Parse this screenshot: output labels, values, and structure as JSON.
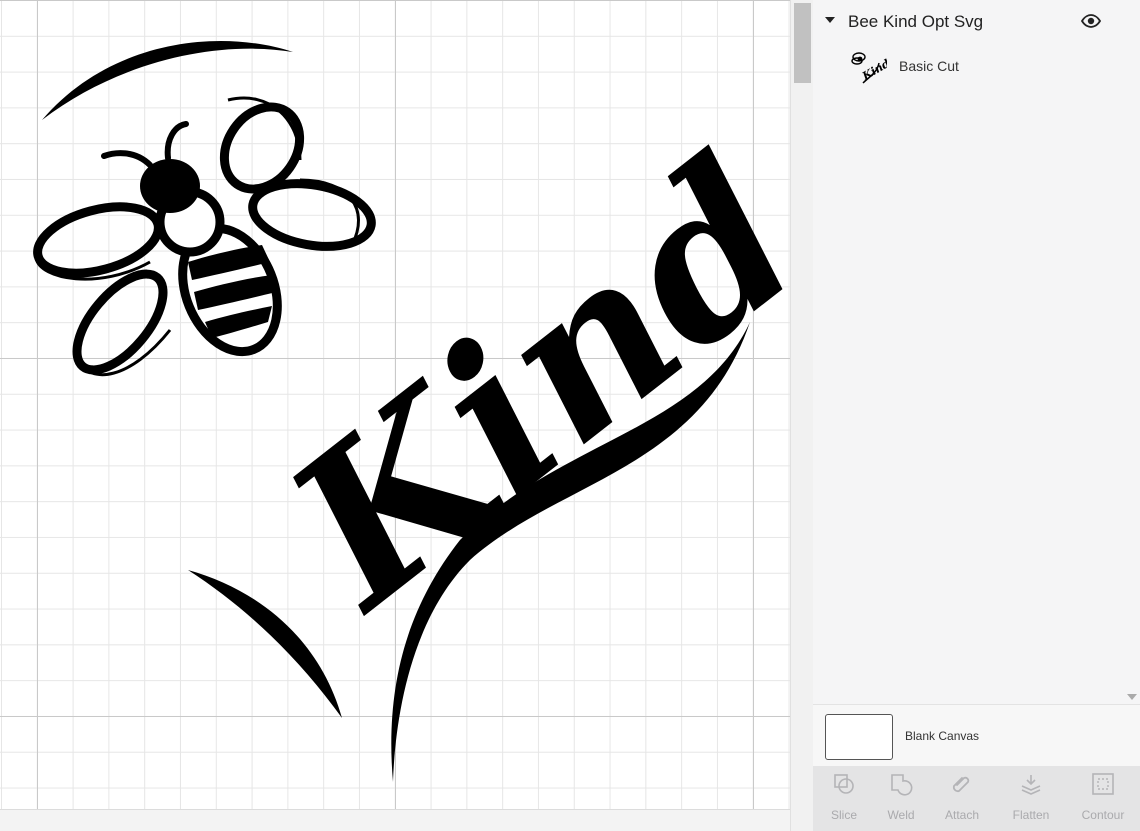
{
  "layers_panel": {
    "group": {
      "title": "Bee Kind Opt Svg",
      "visible": true
    },
    "layers": [
      {
        "name": "Basic Cut",
        "thumbnail_text": "Kind"
      }
    ]
  },
  "canvas_setting": {
    "label": "Blank Canvas",
    "swatch_color": "#ffffff"
  },
  "toolbar": {
    "tools": [
      {
        "label": "Slice",
        "icon": "slice-icon",
        "enabled": false
      },
      {
        "label": "Weld",
        "icon": "weld-icon",
        "enabled": false
      },
      {
        "label": "Attach",
        "icon": "attach-icon",
        "enabled": false
      },
      {
        "label": "Flatten",
        "icon": "flatten-icon",
        "enabled": false
      },
      {
        "label": "Contour",
        "icon": "contour-icon",
        "enabled": false
      }
    ]
  },
  "design": {
    "text": "Kind",
    "color": "#000000"
  }
}
